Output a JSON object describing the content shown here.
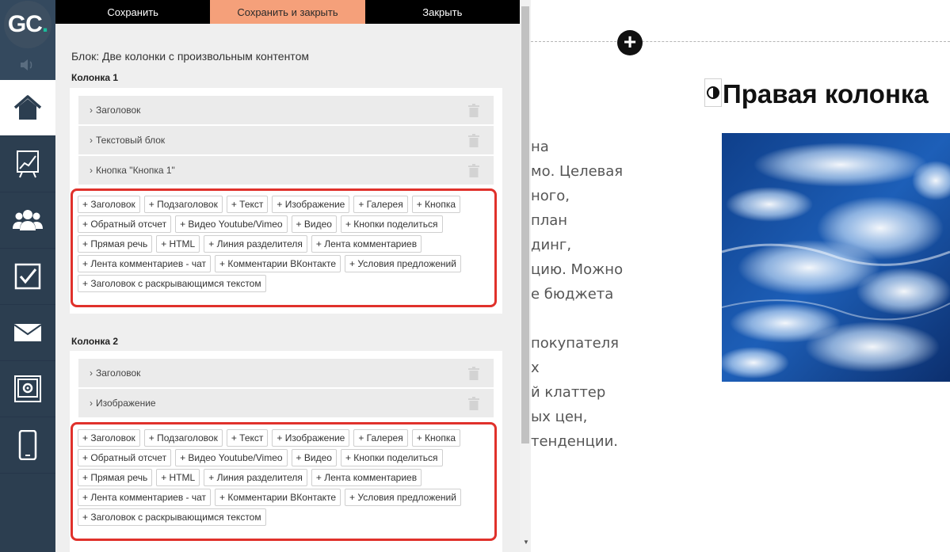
{
  "nav": {
    "logo_text": "GC",
    "logo_dot": ".",
    "items": [
      {
        "name": "home",
        "icon": "home-icon",
        "active": true
      },
      {
        "name": "stats",
        "icon": "chart-icon"
      },
      {
        "name": "users",
        "icon": "users-icon"
      },
      {
        "name": "tasks",
        "icon": "checkbox-icon"
      },
      {
        "name": "messages",
        "icon": "mail-icon"
      },
      {
        "name": "settings",
        "icon": "safe-icon"
      },
      {
        "name": "mobile",
        "icon": "mobile-icon"
      }
    ],
    "accent": "#1abc9c"
  },
  "toolbar": {
    "save_label": "Сохранить",
    "save_close_label": "Сохранить и закрыть",
    "close_label": "Закрыть",
    "accent": "#f5a07a"
  },
  "editor": {
    "block_title": "Блок: Две колонки с произвольным контентом",
    "column1": {
      "title": "Колонка 1",
      "rows": [
        "Заголовок",
        "Текстовый блок",
        "Кнопка \"Кнопка 1\""
      ]
    },
    "column2": {
      "title": "Колонка 2",
      "rows": [
        "Заголовок",
        "Изображение"
      ]
    },
    "add_chips": [
      [
        "+ Заголовок",
        "+ Подзаголовок",
        "+ Текст",
        "+ Изображение",
        "+ Галерея",
        "+ Кнопка"
      ],
      [
        "+ Обратный отсчет",
        "+ Видео Youtube/Vimeo",
        "+ Видео",
        "+ Кнопки поделиться"
      ],
      [
        "+ Прямая речь",
        "+ HTML",
        "+ Линия разделителя",
        "+ Лента комментариев"
      ],
      [
        "+ Лента комментариев - чат",
        "+ Комментарии ВКонтакте",
        "+ Условия предложений"
      ],
      [
        "+ Заголовок с раскрывающимся текстом"
      ]
    ],
    "highlight_color": "#e0312b"
  },
  "preview": {
    "left_text_lines": [
      "на",
      "мо. Целевая",
      "ного,",
      "план",
      "динг,",
      "цию. Можно",
      "е бюджета",
      "",
      "покупателя",
      "х",
      "й клаттер",
      "ых цен,",
      "тенденции."
    ],
    "right_heading": "Правая колонка",
    "image_desc_icon": "ocean-water-image"
  }
}
